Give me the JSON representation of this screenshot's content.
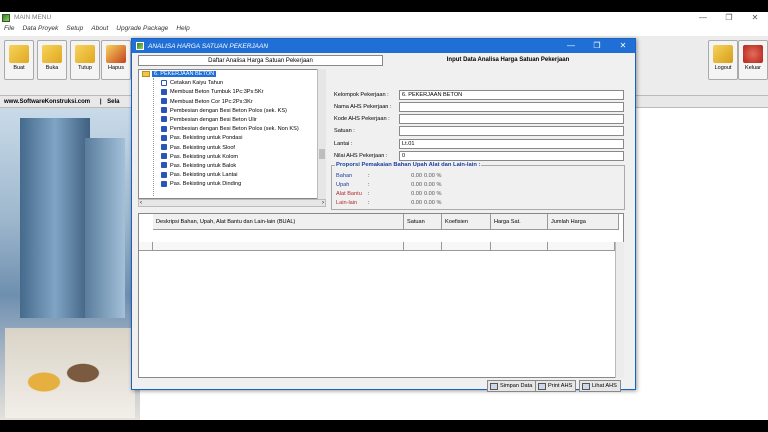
{
  "main_window": {
    "title": "MAIN MENU",
    "controls": [
      "—",
      "❐",
      "✕"
    ]
  },
  "menu": [
    "File",
    "Data Proyek",
    "Setup",
    "About",
    "Upgrade Package",
    "Help"
  ],
  "toolbar": {
    "buttons": [
      {
        "label": "Buat",
        "icon": "folder-new-icon"
      },
      {
        "label": "Buka",
        "icon": "folder-open-icon"
      },
      {
        "label": "Tutup",
        "icon": "folder-close-icon"
      },
      {
        "label": "Hapus",
        "icon": "folder-delete-icon"
      }
    ],
    "right_buttons": [
      {
        "label": "Logout",
        "icon": "key-icon"
      },
      {
        "label": "Keluar",
        "icon": "power-icon"
      }
    ]
  },
  "ribbon": {
    "site": "www.SoftwareKonstruksi.com",
    "separator": "|",
    "next": "Sela"
  },
  "dialog": {
    "title": "ANALISA HARGA SATUAN PEKERJAAN",
    "left_header": "Daftar Analisa Harga Satuan Pekerjaan",
    "right_header": "Input Data Analisa Harga Satuan Pekerjaan",
    "tree": {
      "root": "6.  PEKERJAAN BETON",
      "items": [
        "Cetakan Kaiyu Tahun",
        "Membuat Beton Tumbuk 1Pc:3Ps:5Kr",
        "Membuat Beton Cor 1Pc:2Ps:3Kr",
        "Pembesian dengan Besi Beton Polos (sek. KS)",
        "Pembesian dengan Besi Beton Ulir",
        "Pembesian dengan Besi Beton Polos (sek. Non KS)",
        "Pas. Bekisting untuk Pondasi",
        "Pas. Bekisting untuk Sloof",
        "Pas. Bekisting untuk Kolom",
        "Pas. Bekisting untuk Balok",
        "Pas. Bekisting untuk Lantai",
        "Pas. Bekisting untuk Dinding"
      ]
    },
    "form": {
      "kelompok_label": "Kelompok Pekerjaan :",
      "kelompok_value": "6.  PEKERJAAN BETON",
      "nama_label": "Nama AHS Pekerjaan :",
      "nama_value": "",
      "kode_label": "Kode AHS Pekerjaan :",
      "kode_value": "",
      "satuan_label": "Satuan :",
      "satuan_value": "",
      "lantai_label": "Lantai :",
      "lantai_value": "Lt.01",
      "nilai_label": "Nilai AHS Pekerjaan :",
      "nilai_value": "0"
    },
    "proporsi": {
      "title": "Proporsi Pemakaian Bahan Upah Alat dan Lain-lain :",
      "rows": [
        {
          "label": "Bahan",
          "colon": ":",
          "value": "0.00",
          "pct": "0.00 %",
          "color": "#1a3fa0"
        },
        {
          "label": "Upah",
          "colon": ":",
          "value": "0.00",
          "pct": "0.00 %",
          "color": "#1a3fa0"
        },
        {
          "label": "Alat Bantu",
          "colon": ":",
          "value": "0.00",
          "pct": "0.00 %",
          "color": "#b02a2a"
        },
        {
          "label": "Lain-lain",
          "colon": ":",
          "value": "0.00",
          "pct": "0.00 %",
          "color": "#b02a2a"
        }
      ]
    },
    "grid": {
      "columns": [
        "Deskripsi Bahan, Upah, Alat Bantu dan Lain-lain (BUAL)",
        "Satuan",
        "Koefisien",
        "Harga Sat.",
        "Jumlah Harga"
      ]
    },
    "buttons": {
      "save": "Simpan Data",
      "print": "Print AHS",
      "view": "Lihat AHS"
    }
  }
}
